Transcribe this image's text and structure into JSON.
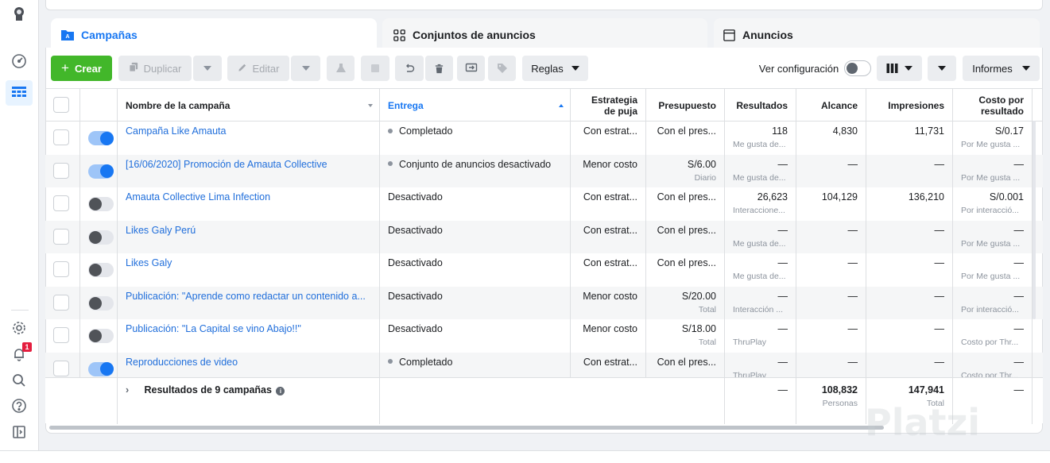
{
  "tabs": {
    "campaigns": "Campañas",
    "adsets": "Conjuntos de anuncios",
    "ads": "Anuncios"
  },
  "toolbar": {
    "create": "Crear",
    "duplicate": "Duplicar",
    "edit": "Editar",
    "rules": "Reglas",
    "view_config": "Ver configuración",
    "reports": "Informes"
  },
  "columns": {
    "name": "Nombre de la campaña",
    "delivery": "Entrega",
    "bid_strategy": "Estrategia de puja",
    "budget": "Presupuesto",
    "results": "Resultados",
    "reach": "Alcance",
    "impressions": "Impresiones",
    "cost": "Costo por resultado"
  },
  "rows": [
    {
      "toggle": "on",
      "name": "Campaña Like Amauta",
      "delivery": "Completado",
      "delivery_dot": true,
      "bid": "Con estrat...",
      "budget": "Con el pres...",
      "budget_sub": "",
      "results": "118",
      "results_sub": "Me gusta de...",
      "reach": "4,830",
      "impressions": "11,731",
      "cost": "S/0.17",
      "cost_sub": "Por Me gusta ..."
    },
    {
      "toggle": "on",
      "name": "[16/06/2020] Promoción de Amauta Collective",
      "delivery": "Conjunto de anuncios desactivado",
      "delivery_dot": true,
      "bid": "Menor costo",
      "budget": "S/6.00",
      "budget_sub": "Diario",
      "results": "—",
      "results_sub": "Me gusta de...",
      "reach": "—",
      "impressions": "—",
      "cost": "—",
      "cost_sub": "Por Me gusta ..."
    },
    {
      "toggle": "off",
      "name": "Amauta Collective Lima Infection",
      "delivery": "Desactivado",
      "delivery_dot": false,
      "bid": "Con estrat...",
      "budget": "Con el pres...",
      "budget_sub": "",
      "results": "26,623",
      "results_sub": "Interaccione...",
      "reach": "104,129",
      "impressions": "136,210",
      "cost": "S/0.001",
      "cost_sub": "Por interacció..."
    },
    {
      "toggle": "off",
      "name": "Likes Galy Perú",
      "delivery": "Desactivado",
      "delivery_dot": false,
      "bid": "Con estrat...",
      "budget": "Con el pres...",
      "budget_sub": "",
      "results": "—",
      "results_sub": "Me gusta de...",
      "reach": "—",
      "impressions": "—",
      "cost": "—",
      "cost_sub": "Por Me gusta ..."
    },
    {
      "toggle": "off",
      "name": "Likes Galy",
      "delivery": "Desactivado",
      "delivery_dot": false,
      "bid": "Con estrat...",
      "budget": "Con el pres...",
      "budget_sub": "",
      "results": "—",
      "results_sub": "Me gusta de...",
      "reach": "—",
      "impressions": "—",
      "cost": "—",
      "cost_sub": "Por Me gusta ..."
    },
    {
      "toggle": "off",
      "name": "Publicación: \"Aprende como redactar un contenido a...",
      "delivery": "Desactivado",
      "delivery_dot": false,
      "bid": "Menor costo",
      "budget": "S/20.00",
      "budget_sub": "Total",
      "results": "—",
      "results_sub": "Interacción ...",
      "reach": "—",
      "impressions": "—",
      "cost": "—",
      "cost_sub": "Por interacció..."
    },
    {
      "toggle": "off",
      "name": "Publicación: \"La Capital se vino Abajo!!\"",
      "delivery": "Desactivado",
      "delivery_dot": false,
      "bid": "Menor costo",
      "budget": "S/18.00",
      "budget_sub": "Total",
      "results": "—",
      "results_sub": "ThruPlay",
      "reach": "—",
      "impressions": "—",
      "cost": "—",
      "cost_sub": "Costo por Thr..."
    },
    {
      "toggle": "on",
      "name": "Reproducciones de video",
      "delivery": "Completado",
      "delivery_dot": true,
      "bid": "Con estrat...",
      "budget": "Con el pres...",
      "budget_sub": "",
      "results": "—",
      "results_sub": "ThruPlay",
      "reach": "—",
      "impressions": "—",
      "cost": "—",
      "cost_sub": "Costo por Thr..."
    }
  ],
  "footer": {
    "label": "Resultados de 9 campañas",
    "results": "—",
    "reach": "108,832",
    "reach_sub": "Personas",
    "impressions": "147,941",
    "impressions_sub": "Total",
    "cost": "—"
  },
  "watermark": "Platzi",
  "notifications_count": "1",
  "colors": {
    "accent": "#1877f2",
    "create": "#42b72a",
    "link": "#216fdb"
  }
}
